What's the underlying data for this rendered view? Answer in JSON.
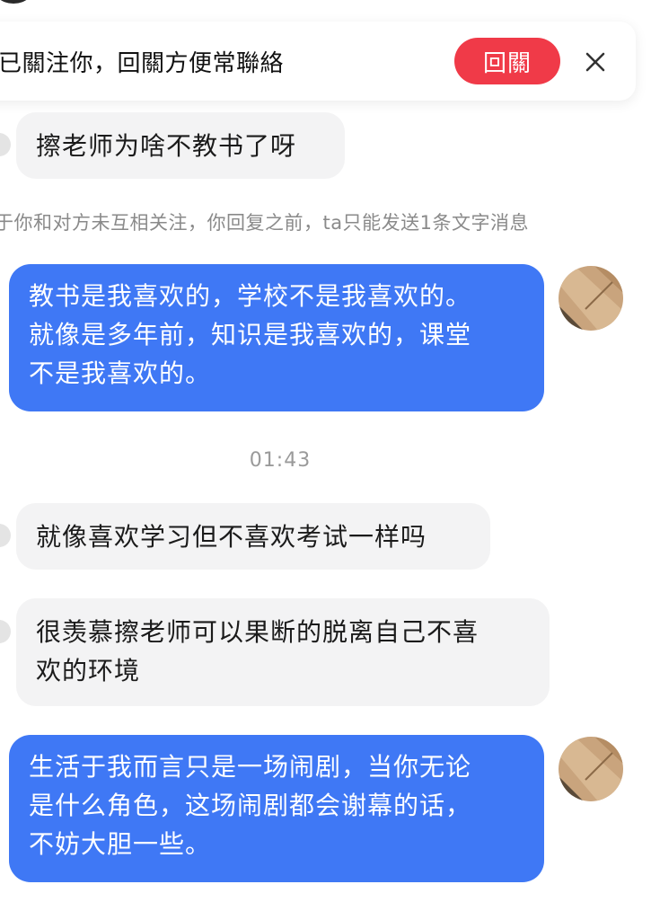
{
  "banner": {
    "text": "已關注你，回關方便常聯絡",
    "follow_button": "回關",
    "close_icon": "close-icon"
  },
  "notice": "于你和对方未互相关注，你回复之前，ta只能发送1条文字消息",
  "timestamp": "01:43",
  "messages": [
    {
      "side": "in",
      "lines": [
        "擦老师为啥不教书了呀"
      ]
    },
    {
      "side": "out",
      "lines": [
        "教书是我喜欢的，学校不是我喜欢的。",
        "就像是多年前，知识是我喜欢的，课堂",
        "不是我喜欢的。"
      ]
    },
    {
      "side": "in",
      "lines": [
        "就像喜欢学习但不喜欢考试一样吗"
      ]
    },
    {
      "side": "in",
      "lines": [
        "很羡慕擦老师可以果断的脱离自己不喜",
        "欢的环境"
      ]
    },
    {
      "side": "out",
      "lines": [
        "生活于我而言只是一场闹剧，当你无论",
        "是什么角色，这场闹剧都会谢幕的话，",
        "不妨大胆一些。"
      ]
    }
  ],
  "colors": {
    "outgoing_bubble": "#3f78f5",
    "incoming_bubble": "#f3f3f4",
    "follow_button": "#f03a48"
  }
}
